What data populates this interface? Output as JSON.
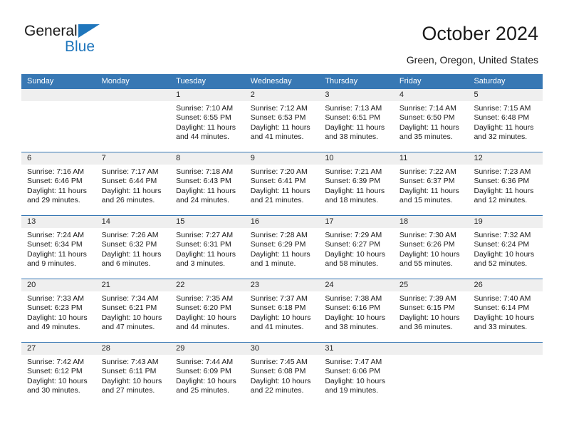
{
  "brand": {
    "name_part1": "General",
    "name_part2": "Blue",
    "accent_color": "#1f76bc"
  },
  "header": {
    "title": "October 2024",
    "subtitle": "Green, Oregon, United States"
  },
  "calendar": {
    "header_bg": "#3878b4",
    "daynum_bg": "#efefef",
    "weekdays": [
      "Sunday",
      "Monday",
      "Tuesday",
      "Wednesday",
      "Thursday",
      "Friday",
      "Saturday"
    ],
    "labels": {
      "sunrise": "Sunrise:",
      "sunset": "Sunset:",
      "daylight": "Daylight:"
    },
    "weeks": [
      [
        {
          "day": "",
          "sunrise": "",
          "sunset": "",
          "daylight": ""
        },
        {
          "day": "",
          "sunrise": "",
          "sunset": "",
          "daylight": ""
        },
        {
          "day": "1",
          "sunrise": "Sunrise: 7:10 AM",
          "sunset": "Sunset: 6:55 PM",
          "daylight": "Daylight: 11 hours and 44 minutes."
        },
        {
          "day": "2",
          "sunrise": "Sunrise: 7:12 AM",
          "sunset": "Sunset: 6:53 PM",
          "daylight": "Daylight: 11 hours and 41 minutes."
        },
        {
          "day": "3",
          "sunrise": "Sunrise: 7:13 AM",
          "sunset": "Sunset: 6:51 PM",
          "daylight": "Daylight: 11 hours and 38 minutes."
        },
        {
          "day": "4",
          "sunrise": "Sunrise: 7:14 AM",
          "sunset": "Sunset: 6:50 PM",
          "daylight": "Daylight: 11 hours and 35 minutes."
        },
        {
          "day": "5",
          "sunrise": "Sunrise: 7:15 AM",
          "sunset": "Sunset: 6:48 PM",
          "daylight": "Daylight: 11 hours and 32 minutes."
        }
      ],
      [
        {
          "day": "6",
          "sunrise": "Sunrise: 7:16 AM",
          "sunset": "Sunset: 6:46 PM",
          "daylight": "Daylight: 11 hours and 29 minutes."
        },
        {
          "day": "7",
          "sunrise": "Sunrise: 7:17 AM",
          "sunset": "Sunset: 6:44 PM",
          "daylight": "Daylight: 11 hours and 26 minutes."
        },
        {
          "day": "8",
          "sunrise": "Sunrise: 7:18 AM",
          "sunset": "Sunset: 6:43 PM",
          "daylight": "Daylight: 11 hours and 24 minutes."
        },
        {
          "day": "9",
          "sunrise": "Sunrise: 7:20 AM",
          "sunset": "Sunset: 6:41 PM",
          "daylight": "Daylight: 11 hours and 21 minutes."
        },
        {
          "day": "10",
          "sunrise": "Sunrise: 7:21 AM",
          "sunset": "Sunset: 6:39 PM",
          "daylight": "Daylight: 11 hours and 18 minutes."
        },
        {
          "day": "11",
          "sunrise": "Sunrise: 7:22 AM",
          "sunset": "Sunset: 6:37 PM",
          "daylight": "Daylight: 11 hours and 15 minutes."
        },
        {
          "day": "12",
          "sunrise": "Sunrise: 7:23 AM",
          "sunset": "Sunset: 6:36 PM",
          "daylight": "Daylight: 11 hours and 12 minutes."
        }
      ],
      [
        {
          "day": "13",
          "sunrise": "Sunrise: 7:24 AM",
          "sunset": "Sunset: 6:34 PM",
          "daylight": "Daylight: 11 hours and 9 minutes."
        },
        {
          "day": "14",
          "sunrise": "Sunrise: 7:26 AM",
          "sunset": "Sunset: 6:32 PM",
          "daylight": "Daylight: 11 hours and 6 minutes."
        },
        {
          "day": "15",
          "sunrise": "Sunrise: 7:27 AM",
          "sunset": "Sunset: 6:31 PM",
          "daylight": "Daylight: 11 hours and 3 minutes."
        },
        {
          "day": "16",
          "sunrise": "Sunrise: 7:28 AM",
          "sunset": "Sunset: 6:29 PM",
          "daylight": "Daylight: 11 hours and 1 minute."
        },
        {
          "day": "17",
          "sunrise": "Sunrise: 7:29 AM",
          "sunset": "Sunset: 6:27 PM",
          "daylight": "Daylight: 10 hours and 58 minutes."
        },
        {
          "day": "18",
          "sunrise": "Sunrise: 7:30 AM",
          "sunset": "Sunset: 6:26 PM",
          "daylight": "Daylight: 10 hours and 55 minutes."
        },
        {
          "day": "19",
          "sunrise": "Sunrise: 7:32 AM",
          "sunset": "Sunset: 6:24 PM",
          "daylight": "Daylight: 10 hours and 52 minutes."
        }
      ],
      [
        {
          "day": "20",
          "sunrise": "Sunrise: 7:33 AM",
          "sunset": "Sunset: 6:23 PM",
          "daylight": "Daylight: 10 hours and 49 minutes."
        },
        {
          "day": "21",
          "sunrise": "Sunrise: 7:34 AM",
          "sunset": "Sunset: 6:21 PM",
          "daylight": "Daylight: 10 hours and 47 minutes."
        },
        {
          "day": "22",
          "sunrise": "Sunrise: 7:35 AM",
          "sunset": "Sunset: 6:20 PM",
          "daylight": "Daylight: 10 hours and 44 minutes."
        },
        {
          "day": "23",
          "sunrise": "Sunrise: 7:37 AM",
          "sunset": "Sunset: 6:18 PM",
          "daylight": "Daylight: 10 hours and 41 minutes."
        },
        {
          "day": "24",
          "sunrise": "Sunrise: 7:38 AM",
          "sunset": "Sunset: 6:16 PM",
          "daylight": "Daylight: 10 hours and 38 minutes."
        },
        {
          "day": "25",
          "sunrise": "Sunrise: 7:39 AM",
          "sunset": "Sunset: 6:15 PM",
          "daylight": "Daylight: 10 hours and 36 minutes."
        },
        {
          "day": "26",
          "sunrise": "Sunrise: 7:40 AM",
          "sunset": "Sunset: 6:14 PM",
          "daylight": "Daylight: 10 hours and 33 minutes."
        }
      ],
      [
        {
          "day": "27",
          "sunrise": "Sunrise: 7:42 AM",
          "sunset": "Sunset: 6:12 PM",
          "daylight": "Daylight: 10 hours and 30 minutes."
        },
        {
          "day": "28",
          "sunrise": "Sunrise: 7:43 AM",
          "sunset": "Sunset: 6:11 PM",
          "daylight": "Daylight: 10 hours and 27 minutes."
        },
        {
          "day": "29",
          "sunrise": "Sunrise: 7:44 AM",
          "sunset": "Sunset: 6:09 PM",
          "daylight": "Daylight: 10 hours and 25 minutes."
        },
        {
          "day": "30",
          "sunrise": "Sunrise: 7:45 AM",
          "sunset": "Sunset: 6:08 PM",
          "daylight": "Daylight: 10 hours and 22 minutes."
        },
        {
          "day": "31",
          "sunrise": "Sunrise: 7:47 AM",
          "sunset": "Sunset: 6:06 PM",
          "daylight": "Daylight: 10 hours and 19 minutes."
        },
        {
          "day": "",
          "sunrise": "",
          "sunset": "",
          "daylight": ""
        },
        {
          "day": "",
          "sunrise": "",
          "sunset": "",
          "daylight": ""
        }
      ]
    ]
  }
}
